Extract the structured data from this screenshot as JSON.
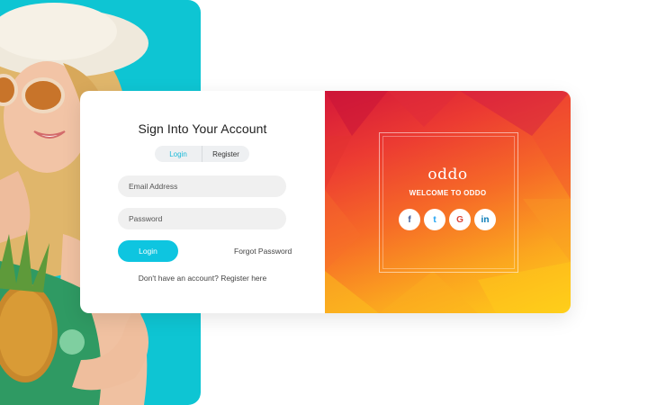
{
  "login_card": {
    "title": "Sign Into Your Account",
    "tabs": [
      {
        "label": "Login",
        "active": true
      },
      {
        "label": "Register",
        "active": false
      }
    ],
    "email_placeholder": "Email Address",
    "password_placeholder": "Password",
    "login_button": "Login",
    "forgot_password": "Forgot Password",
    "register_link": "Don't have an account? Register here"
  },
  "brand_panel": {
    "brand_name": "oddo",
    "welcome_text": "WELCOME TO ODDO",
    "social_buttons": [
      {
        "glyph": "f",
        "icon": "facebook-icon",
        "color": "#3b5998"
      },
      {
        "glyph": "t",
        "icon": "twitter-icon",
        "color": "#1da1f2"
      },
      {
        "glyph": "G",
        "icon": "google-icon",
        "color": "#db4437"
      },
      {
        "glyph": "in",
        "icon": "linkedin-icon",
        "color": "#0077b5"
      }
    ]
  },
  "colors": {
    "accent": "#0ec5e0",
    "photo_background": "#0ec5d3",
    "gradient_top": "#d4173a",
    "gradient_bottom": "#ffd21a"
  },
  "hero_image": {
    "icon": "woman-with-pineapple-photo"
  }
}
